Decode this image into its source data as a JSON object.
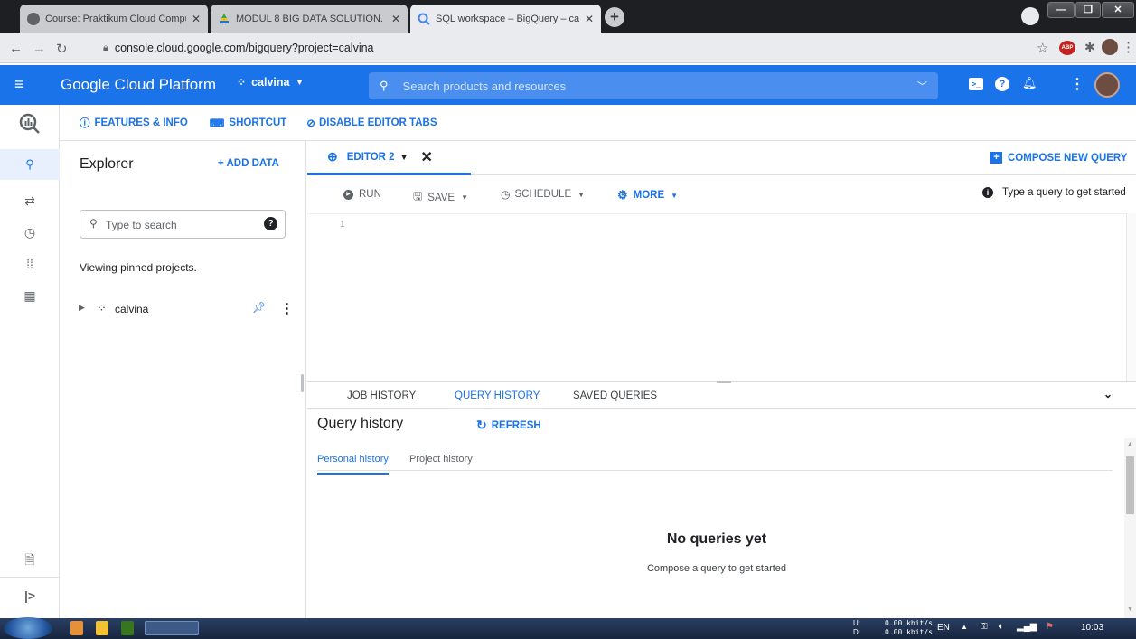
{
  "browser": {
    "tabs": [
      {
        "title": "Course: Praktikum Cloud Compu",
        "fav_color": "#5f6368"
      },
      {
        "title": "MODUL 8 BIG DATA SOLUTION.",
        "fav_color": "#1a73e8"
      },
      {
        "title": "SQL workspace – BigQuery – calv",
        "fav_color": "#4285f4"
      }
    ],
    "new_tab": "+",
    "url": "console.cloud.google.com/bigquery?project=calvina",
    "ext_badge": "ABP"
  },
  "gcp_header": {
    "title": "Google Cloud Platform",
    "project": "calvina",
    "search_placeholder": "Search products and resources"
  },
  "toolbar": {
    "features_info": "FEATURES & INFO",
    "shortcut": "SHORTCUT",
    "disable_editor_tabs": "DISABLE EDITOR TABS"
  },
  "explorer": {
    "title": "Explorer",
    "add_data": "+ ADD DATA",
    "search_placeholder": "Type to search",
    "viewing_text": "Viewing pinned projects.",
    "project_name": "calvina"
  },
  "editor": {
    "tab_label": "EDITOR 2",
    "compose_new_query": "COMPOSE NEW QUERY",
    "run": "RUN",
    "save": "SAVE",
    "schedule": "SCHEDULE",
    "more": "MORE",
    "hint": "Type a query to get started",
    "line_number": "1"
  },
  "bottom_panel": {
    "tabs": [
      "JOB HISTORY",
      "QUERY HISTORY",
      "SAVED QUERIES"
    ],
    "active_tab": "QUERY HISTORY",
    "title": "Query history",
    "refresh": "REFRESH",
    "subtabs": [
      "Personal history",
      "Project history"
    ],
    "empty_title": "No queries yet",
    "empty_subtitle": "Compose a query to get started"
  },
  "taskbar": {
    "upload_label": "U:",
    "download_label": "D:",
    "upload_speed": "0.00 kbit/s",
    "download_speed": "0.00 kbit/s",
    "lang": "EN",
    "time": "10:03"
  },
  "colors": {
    "accent": "#1a73e8",
    "header": "#1a73e8",
    "taskbar": "#1c2c48"
  }
}
